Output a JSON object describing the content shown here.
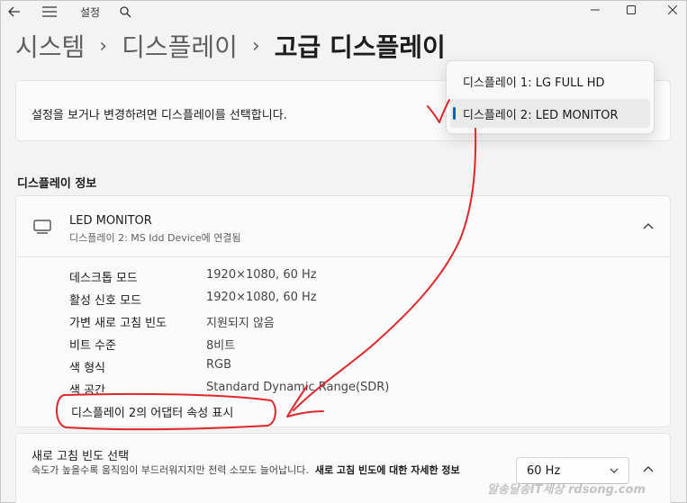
{
  "titlebar": {
    "title": "설정"
  },
  "breadcrumb": {
    "items": [
      "시스템",
      "디스플레이",
      "고급 디스플레이"
    ],
    "separator": "›"
  },
  "select_card": {
    "text": "설정을 보거나 변경하려면 디스플레이를 선택합니다."
  },
  "dropdown": {
    "options": [
      "디스플레이 1: LG FULL HD",
      "디스플레이 2: LED MONITOR"
    ],
    "selected_index": 1
  },
  "display_info": {
    "section_title": "디스플레이 정보",
    "device_name": "LED MONITOR",
    "device_sub": "디스플레이 2: MS Idd Device에 연결됨",
    "properties": [
      {
        "label": "데스크톱 모드",
        "value": "1920×1080, 60 Hz"
      },
      {
        "label": "활성 신호 모드",
        "value": "1920×1080, 60 Hz"
      },
      {
        "label": "가변 새로 고침 빈도",
        "value": "지원되지 않음"
      },
      {
        "label": "비트 수준",
        "value": "8비트"
      },
      {
        "label": "색 형식",
        "value": "RGB"
      },
      {
        "label": "색 공간",
        "value": "Standard Dynamic Range(SDR)"
      }
    ],
    "adapter_link": "디스플레이 2의 어댑터 속성 표시"
  },
  "refresh": {
    "title": "새로 고침 빈도 선택",
    "desc": "속도가 높을수록 움직임이 부드러워지지만 전력 소모도 늘어납니다.",
    "link": "새로 고침 빈도에 대한 자세한 정보",
    "selected": "60 Hz"
  },
  "watermark": "알송달송IT세상 rdsong.com",
  "colors": {
    "accent": "#005fb8",
    "annotation": "#e0262b"
  }
}
